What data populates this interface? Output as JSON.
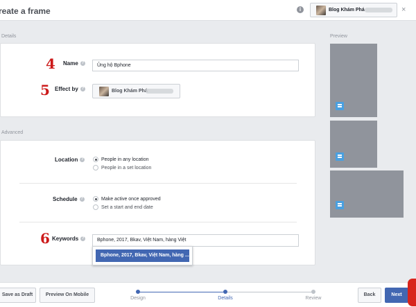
{
  "header": {
    "title": "reate a frame",
    "page_name": "Blog Khám Phá",
    "close_symbol": "×",
    "info_symbol": "i"
  },
  "details": {
    "section_label": "Details",
    "steps_numbers": {
      "name": "4",
      "effect": "5",
      "keywords": "6"
    },
    "name_label": "Name",
    "name_value": "Ủng hộ Bphone",
    "effect_by_label": "Effect by",
    "effect_by_page": "Blog Khám Phá"
  },
  "advanced": {
    "section_label": "Advanced",
    "location_label": "Location",
    "location_options": [
      "People in any location",
      "People in a set location"
    ],
    "schedule_label": "Schedule",
    "schedule_options": [
      "Make active once approved",
      "Set a start and end date"
    ],
    "keywords_label": "Keywords",
    "keywords_value": "Bphone, 2017, Bkav, Việt Nam, hàng Việt",
    "suggestion": "Bphone, 2017, Bkav, Việt Nam, hàng ..."
  },
  "preview": {
    "label": "Preview"
  },
  "footer": {
    "save_draft": "Save as Draft",
    "preview_mobile": "Preview On Mobile",
    "steps": [
      "Design",
      "Details",
      "Review"
    ],
    "active_step": "Details",
    "back": "Back",
    "next": "Next"
  },
  "colors": {
    "accent": "#4267b2",
    "step_number": "#cc1a1a",
    "preview_bg": "#90949c",
    "preview_badge": "#4aa0e0"
  },
  "help_symbol": "?"
}
